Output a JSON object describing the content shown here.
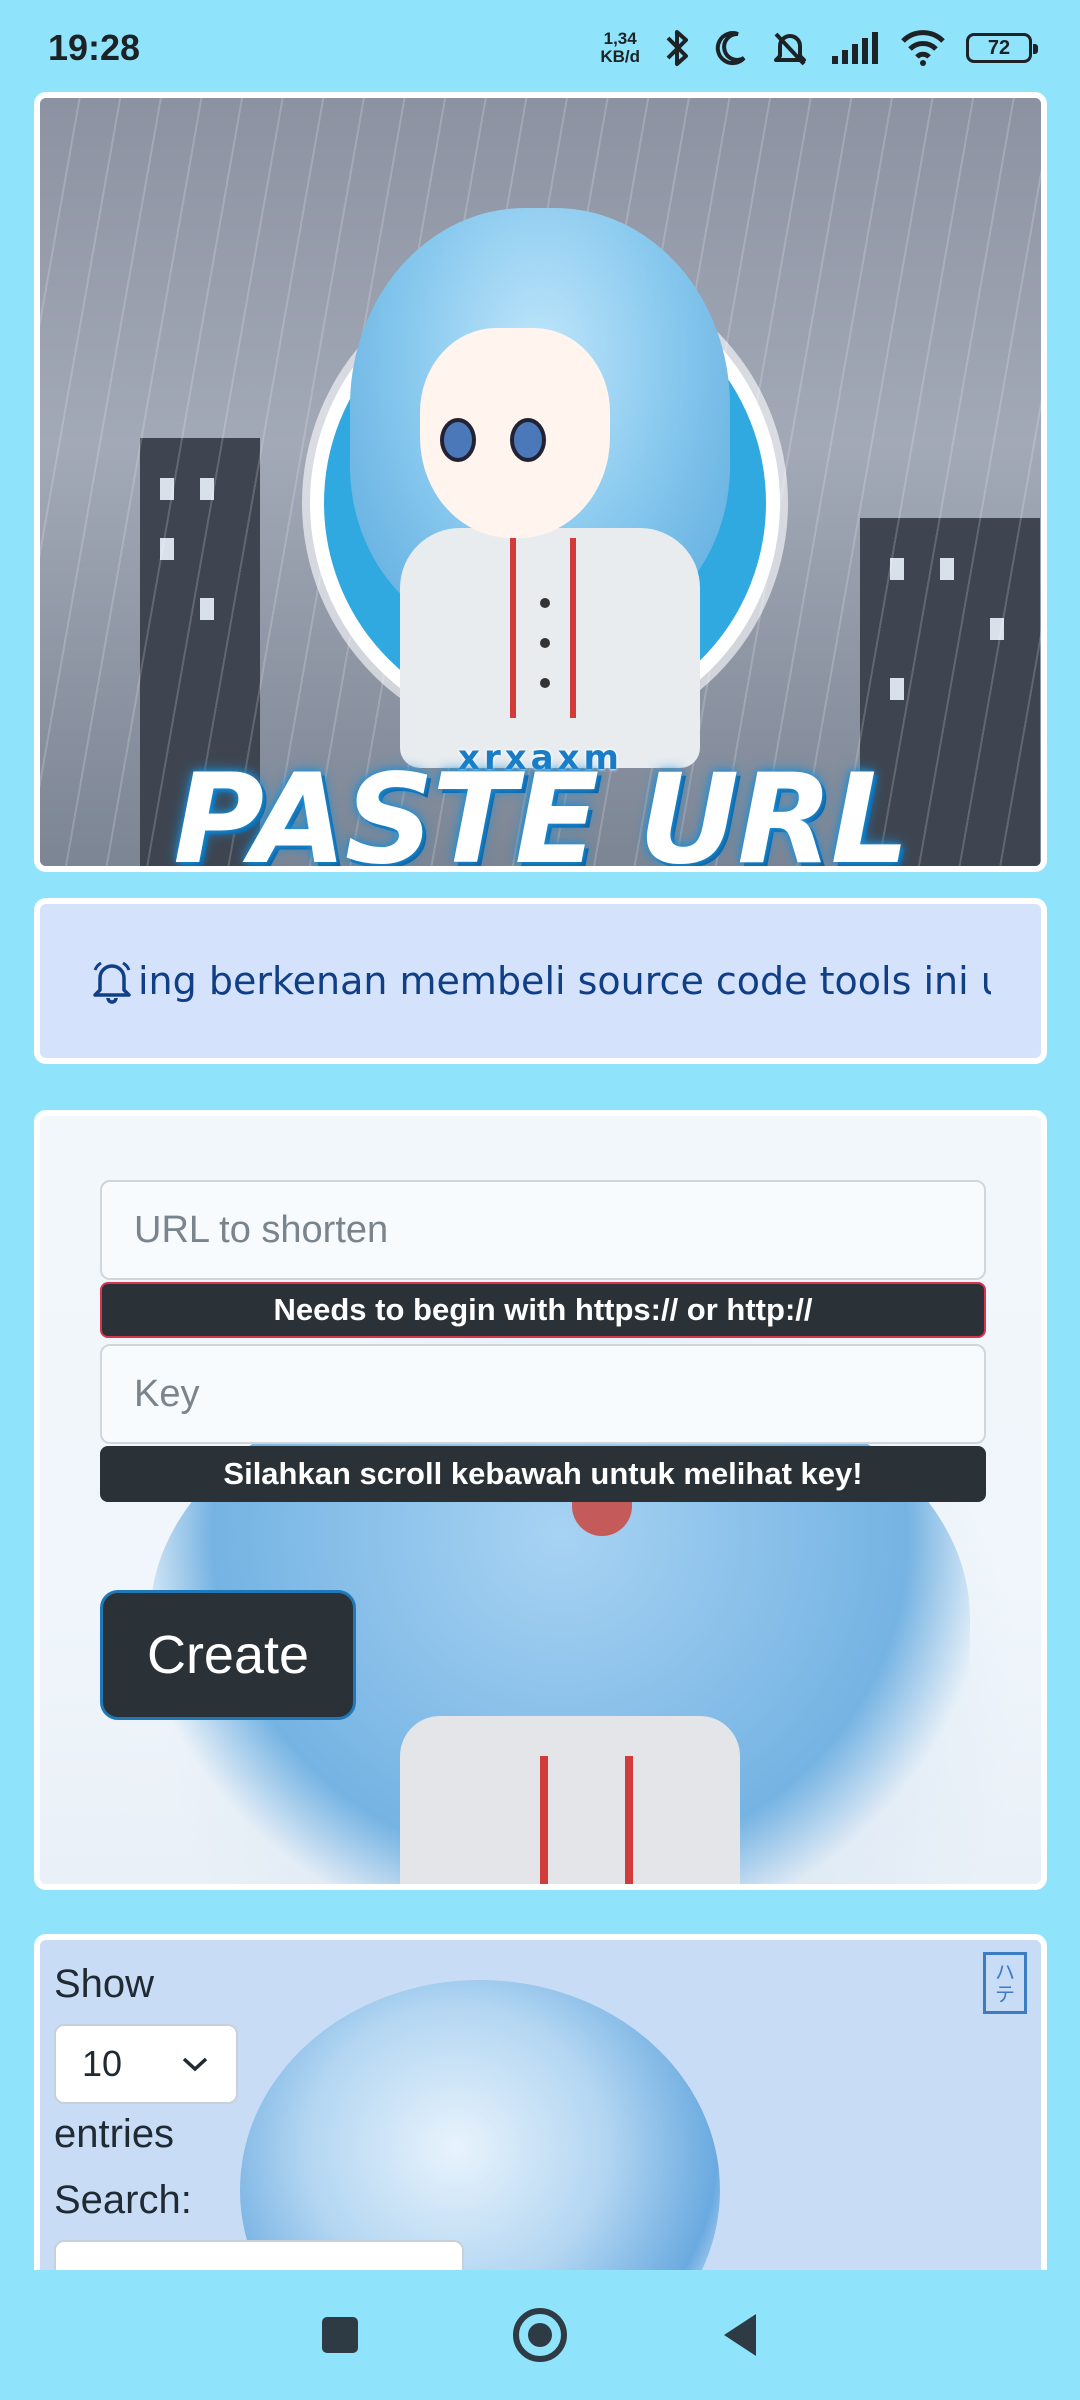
{
  "status_bar": {
    "time": "19:28",
    "net_speed_value": "1,34",
    "net_speed_unit": "KB/d",
    "battery": "72"
  },
  "banner": {
    "brand_small": "xrxaxm",
    "title": "PASTE URL"
  },
  "announcement": {
    "icon": "bell-icon",
    "text": "ing berkenan membeli source code tools ini u"
  },
  "form": {
    "url_placeholder": "URL to shorten",
    "url_hint": "Needs to begin with https:// or http://",
    "key_placeholder": "Key",
    "key_hint": "Silahkan scroll kebawah untuk melihat key!",
    "create_label": "Create"
  },
  "table": {
    "show_label": "Show",
    "length_value": "10",
    "entries_label": "entries",
    "search_label": "Search:"
  },
  "colors": {
    "background": "#8fe4fb",
    "dark_button": "#2a3238",
    "announcement_text": "#103f86"
  }
}
